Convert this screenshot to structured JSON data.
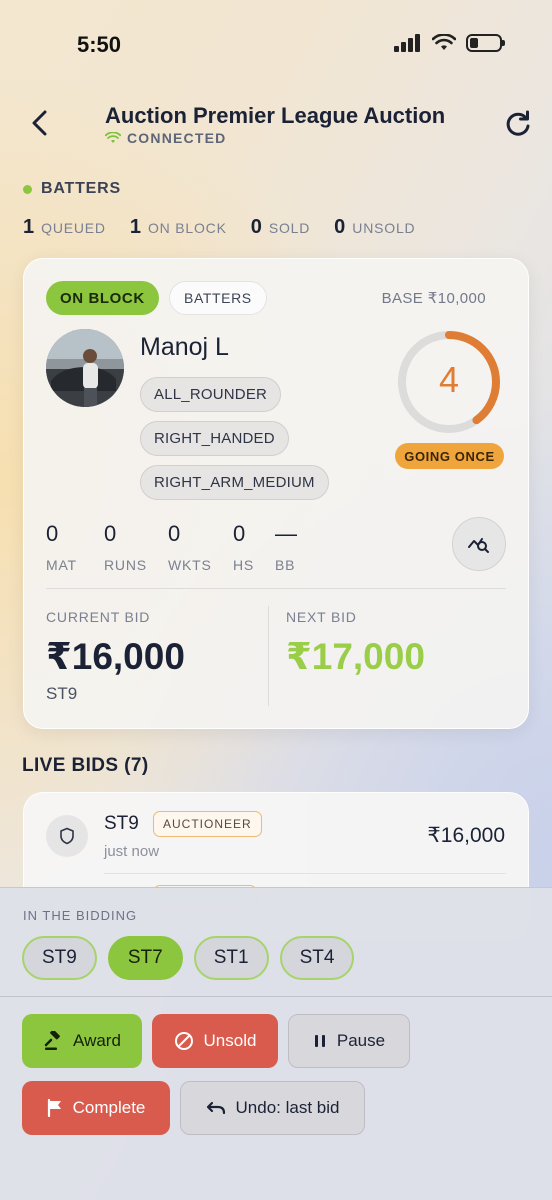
{
  "status_bar": {
    "time": "5:50"
  },
  "header": {
    "title": "Auction Premier League Auction",
    "connection": "CONNECTED"
  },
  "category": {
    "name": "BATTERS",
    "counts": [
      {
        "n": "1",
        "label": "QUEUED"
      },
      {
        "n": "1",
        "label": "ON BLOCK"
      },
      {
        "n": "0",
        "label": "SOLD"
      },
      {
        "n": "0",
        "label": "UNSOLD"
      }
    ]
  },
  "player": {
    "status": "ON BLOCK",
    "category": "BATTERS",
    "base": "BASE ₹10,000",
    "name": "Manoj L",
    "tags": [
      "ALL_ROUNDER",
      "RIGHT_HANDED",
      "RIGHT_ARM_MEDIUM"
    ],
    "timer": "4",
    "timer_fraction": 0.4,
    "timer_state": "GOING ONCE",
    "stats": [
      {
        "value": "0",
        "label": "MAT"
      },
      {
        "value": "0",
        "label": "RUNS"
      },
      {
        "value": "0",
        "label": "WKTS"
      },
      {
        "value": "0",
        "label": "HS"
      },
      {
        "value": "—",
        "label": "BB"
      }
    ],
    "current_bid_label": "CURRENT BID",
    "current_bid": "₹16,000",
    "current_bidder": "ST9",
    "next_bid_label": "NEXT BID",
    "next_bid": "₹17,000"
  },
  "live_bids": {
    "title": "LIVE BIDS (7)",
    "items": [
      {
        "bidder": "ST9",
        "badge": "AUCTIONEER",
        "time": "just now",
        "amount": "₹16,000"
      }
    ]
  },
  "bidding": {
    "title": "IN THE BIDDING",
    "teams": [
      "ST9",
      "ST7",
      "ST1",
      "ST4"
    ]
  },
  "actions": {
    "award": "Award",
    "unsold": "Unsold",
    "pause": "Pause",
    "complete": "Complete",
    "undo": "Undo: last bid"
  },
  "colors": {
    "accent_green": "#8cc63f",
    "danger_red": "#d95b4d",
    "timer_orange": "#e07d34",
    "going_once": "#f0a53c"
  }
}
